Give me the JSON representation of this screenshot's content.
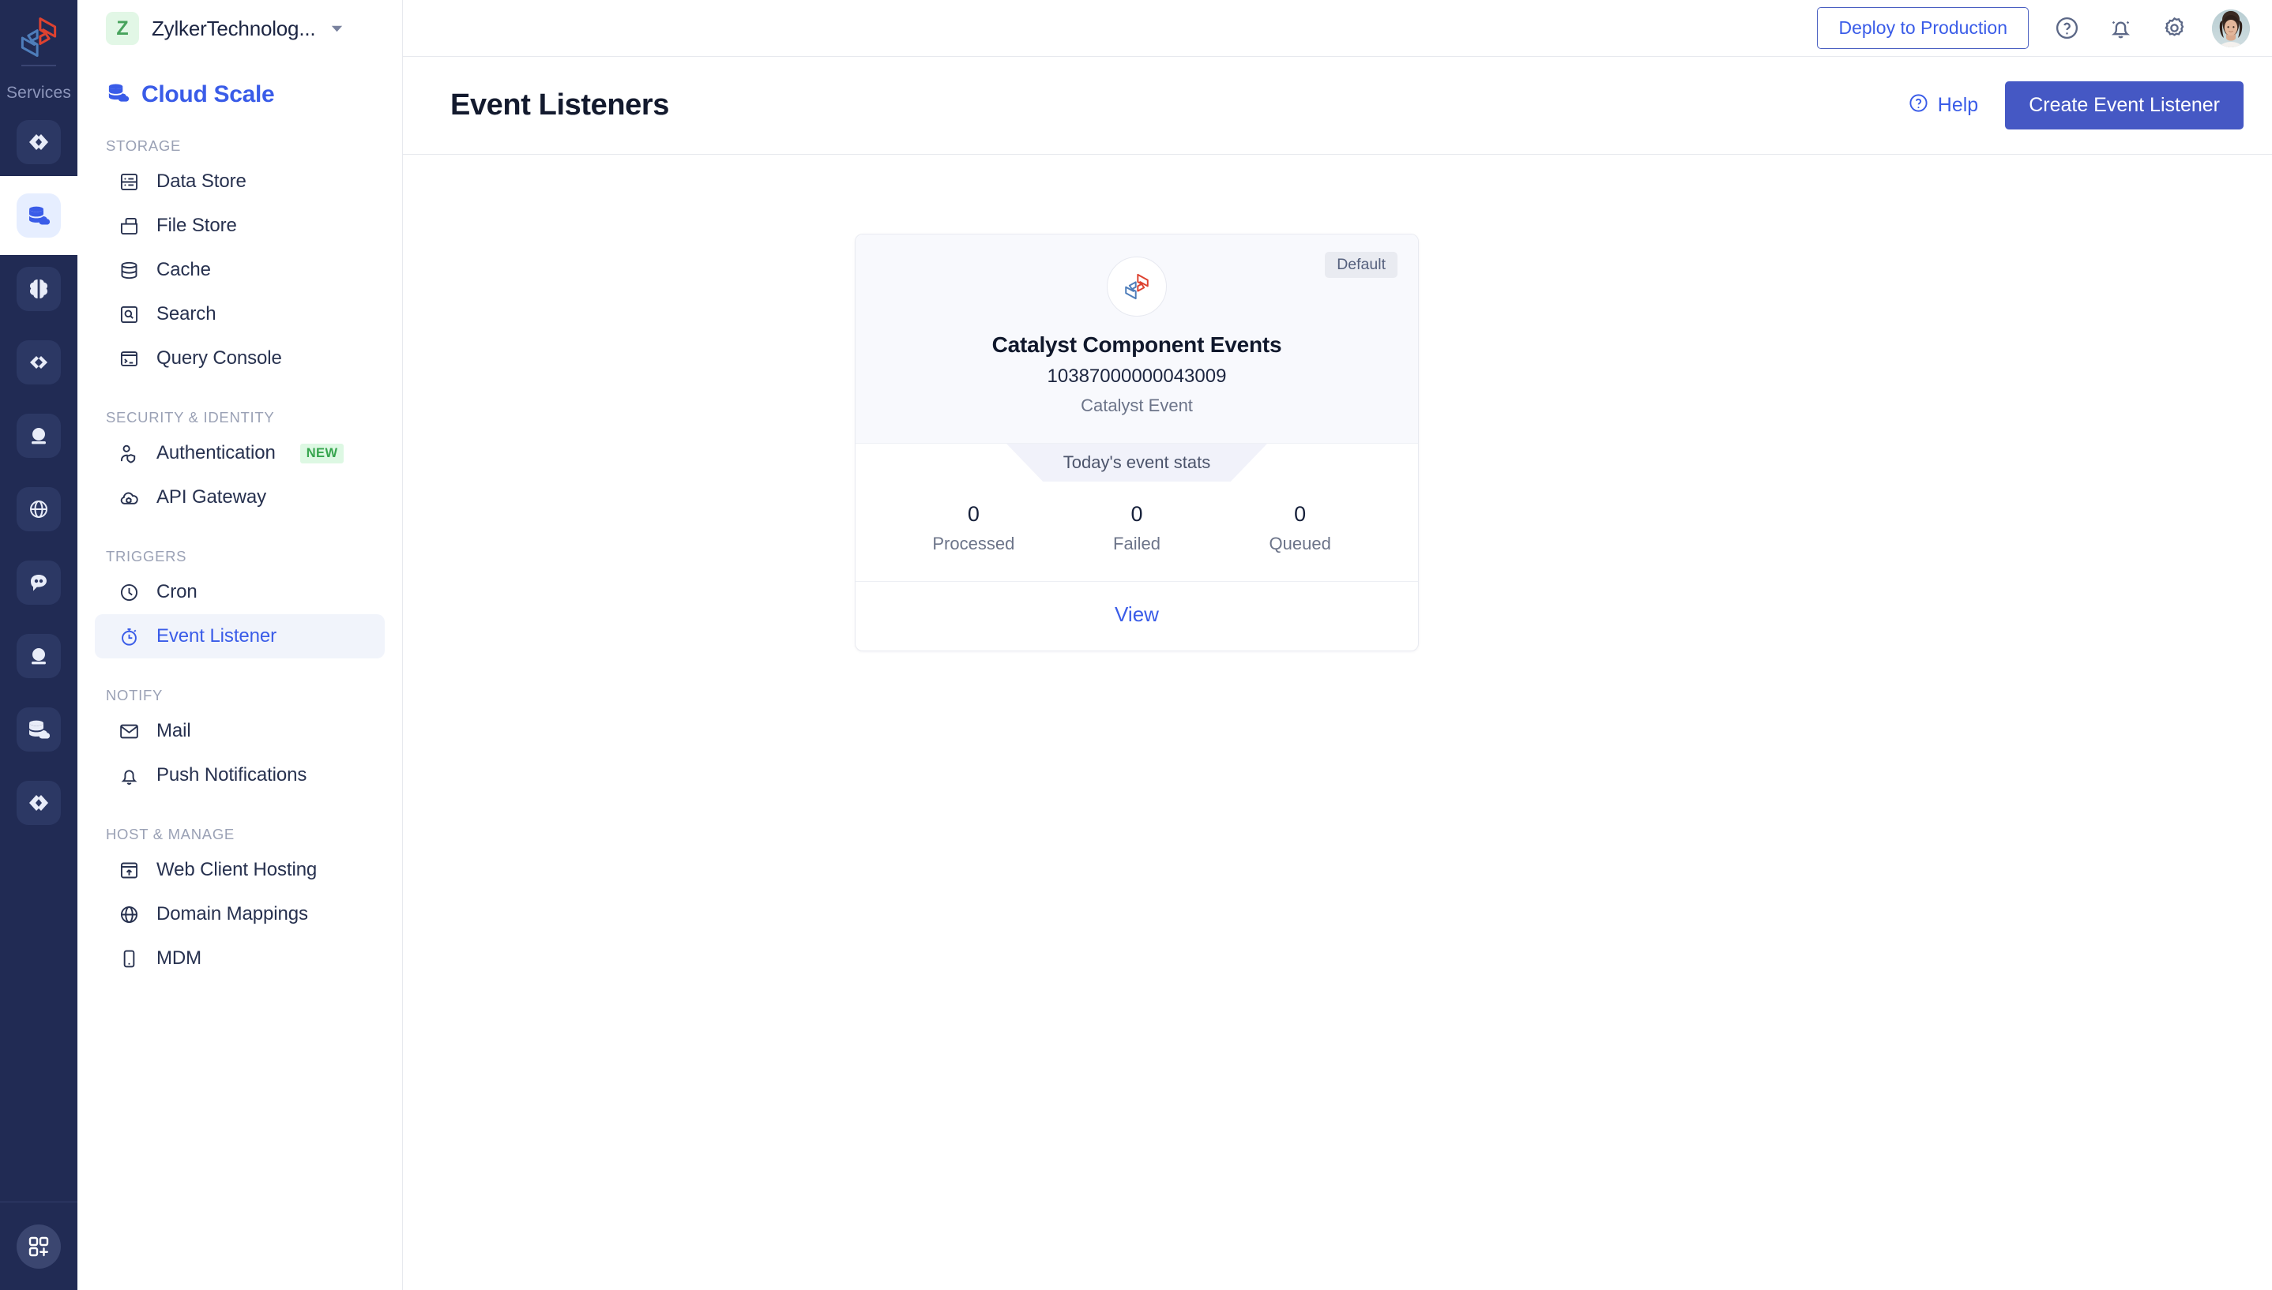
{
  "rail": {
    "brand_icon": "catalyst-logo-icon",
    "services_label": "Services",
    "items": [
      {
        "icon": "code-brackets-icon",
        "name": "serverless"
      },
      {
        "icon": "cloud-database-icon",
        "name": "cloud-scale",
        "active": true
      },
      {
        "icon": "brain-icon",
        "name": "ai"
      },
      {
        "icon": "infinity-code-icon",
        "name": "devops"
      },
      {
        "icon": "crystal-ball-icon",
        "name": "quickml"
      },
      {
        "icon": "globe-icon",
        "name": "web"
      },
      {
        "icon": "chat-bubble-icon",
        "name": "conversations"
      },
      {
        "icon": "crystal-ball-icon",
        "name": "insights"
      },
      {
        "icon": "cloud-database-icon",
        "name": "datastore"
      },
      {
        "icon": "code-brackets-icon",
        "name": "api"
      }
    ],
    "add_icon": "grid-plus-icon"
  },
  "org": {
    "avatar_letter": "Z",
    "name": "ZylkerTechnolog...",
    "caret_icon": "chevron-down-icon"
  },
  "sidebar": {
    "title": "Cloud Scale",
    "title_icon": "cloud-database-icon",
    "groups": [
      {
        "label": "STORAGE",
        "items": [
          {
            "label": "Data Store",
            "icon": "server-rack-icon"
          },
          {
            "label": "File Store",
            "icon": "folder-upload-icon"
          },
          {
            "label": "Cache",
            "icon": "database-icon"
          },
          {
            "label": "Search",
            "icon": "search-box-icon"
          },
          {
            "label": "Query Console",
            "icon": "terminal-icon"
          }
        ]
      },
      {
        "label": "SECURITY & IDENTITY",
        "items": [
          {
            "label": "Authentication",
            "icon": "user-shield-icon",
            "badge": "NEW"
          },
          {
            "label": "API Gateway",
            "icon": "cloud-gear-icon"
          }
        ]
      },
      {
        "label": "TRIGGERS",
        "items": [
          {
            "label": "Cron",
            "icon": "clock-icon"
          },
          {
            "label": "Event Listener",
            "icon": "stopwatch-icon",
            "active": true
          }
        ]
      },
      {
        "label": "NOTIFY",
        "items": [
          {
            "label": "Mail",
            "icon": "envelope-icon"
          },
          {
            "label": "Push Notifications",
            "icon": "bell-icon"
          }
        ]
      },
      {
        "label": "HOST & MANAGE",
        "items": [
          {
            "label": "Web Client Hosting",
            "icon": "window-upload-icon"
          },
          {
            "label": "Domain Mappings",
            "icon": "globe-icon"
          },
          {
            "label": "MDM",
            "icon": "mobile-device-icon"
          }
        ]
      }
    ]
  },
  "topbar": {
    "deploy_label": "Deploy to Production",
    "help_icon": "question-circle-icon",
    "bell_icon": "bell-icon",
    "gear_icon": "gear-icon",
    "avatar": "user-avatar"
  },
  "page": {
    "title": "Event Listeners",
    "help_label": "Help",
    "help_icon": "question-circle-icon",
    "create_label": "Create Event Listener"
  },
  "card": {
    "badge": "Default",
    "logo_icon": "catalyst-logo-icon",
    "title": "Catalyst Component Events",
    "id": "10387000000043009",
    "subtitle": "Catalyst Event",
    "stats_band_label": "Today's event stats",
    "stats": [
      {
        "value": "0",
        "label": "Processed"
      },
      {
        "value": "0",
        "label": "Failed"
      },
      {
        "value": "0",
        "label": "Queued"
      }
    ],
    "view_label": "View"
  },
  "colors": {
    "rail_bg": "#212b54",
    "accent_blue": "#3a5ce8",
    "primary_button": "#4558c4",
    "badge_new_bg": "#ddf8e3",
    "badge_new_text": "#36a54e",
    "card_head_bg": "#f8f9fd",
    "stats_band_bg": "#f1f2fa"
  }
}
